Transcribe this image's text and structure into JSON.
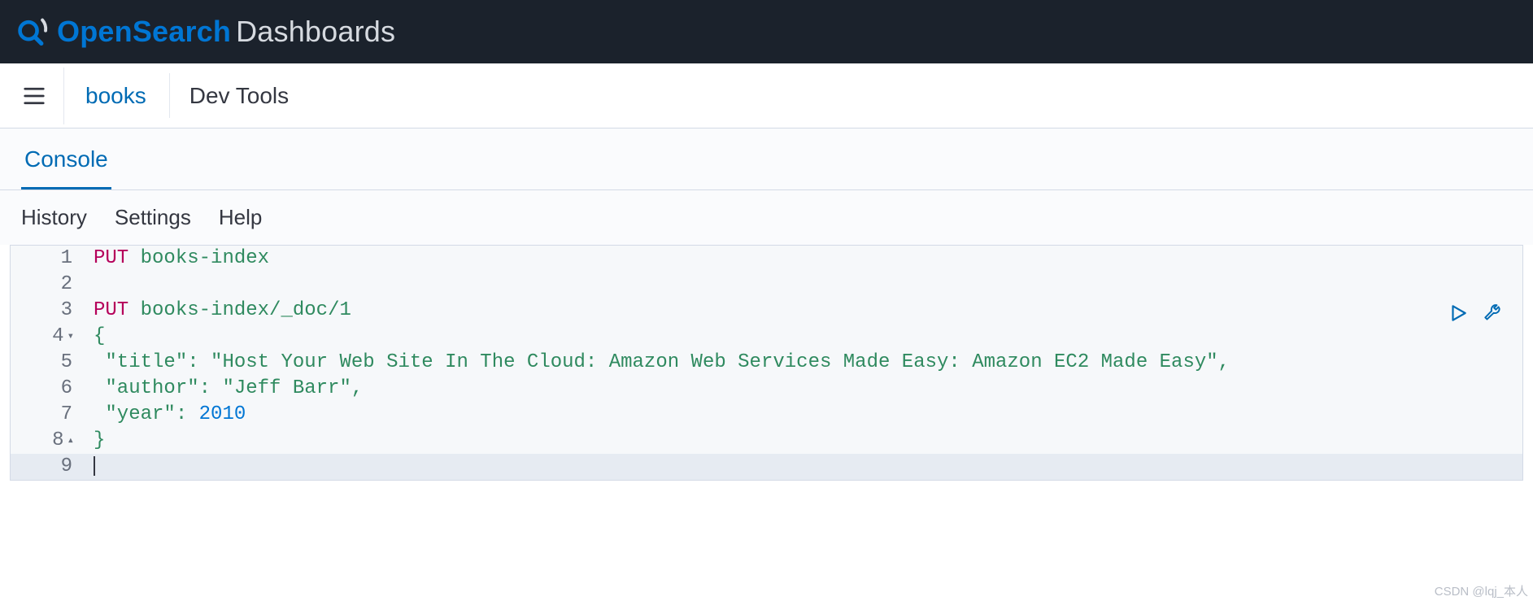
{
  "brand": {
    "open": "Open",
    "search": "Search",
    "dash": "Dashboards"
  },
  "breadcrumb": {
    "link": "books",
    "current": "Dev Tools"
  },
  "tabs": {
    "console": "Console"
  },
  "toolbar": {
    "history": "History",
    "settings": "Settings",
    "help": "Help"
  },
  "editor": {
    "l1_method": "PUT",
    "l1_path": "books-index",
    "l3_method": "PUT",
    "l3_path": "books-index/_doc/1",
    "l4_brace": "{",
    "l5_key": "\"title\"",
    "l5_colon": ": ",
    "l5_val": "\"Host Your Web Site In The Cloud: Amazon Web Services Made Easy: Amazon EC2 Made Easy\"",
    "l5_comma": ",",
    "l6_key": "\"author\"",
    "l6_colon": ": ",
    "l6_val": "\"Jeff Barr\"",
    "l6_comma": ",",
    "l7_key": "\"year\"",
    "l7_colon": ": ",
    "l7_val": "2010",
    "l8_brace": "}",
    "ln": {
      "1": "1",
      "2": "2",
      "3": "3",
      "4": "4",
      "5": "5",
      "6": "6",
      "7": "7",
      "8": "8",
      "9": "9"
    },
    "fold_open": "▾",
    "fold_close": "▴"
  },
  "watermark": "CSDN @lqj_本人"
}
